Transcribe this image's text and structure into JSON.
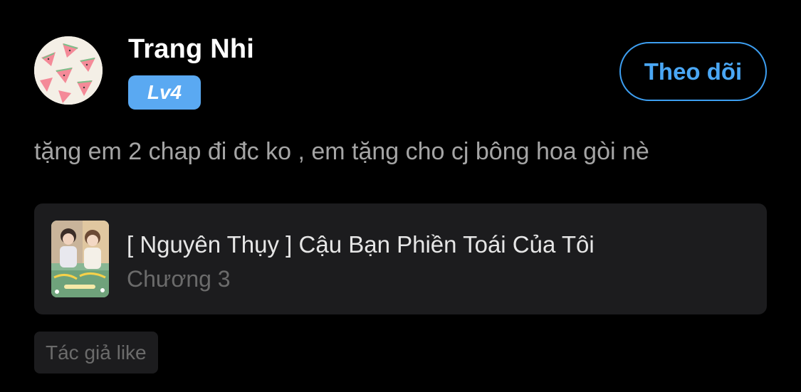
{
  "user": {
    "name": "Trang Nhi",
    "level": "Lv4",
    "avatar_icon": "watermelon-pattern-avatar"
  },
  "follow_button": {
    "label": "Theo dõi"
  },
  "comment": {
    "text": "tặng em 2 chap đi đc ko , em tặng cho cj  bông hoa gòi nè"
  },
  "story": {
    "title": "[ Nguyên Thụy ] Cậu Bạn Phiền Toái Của Tôi",
    "chapter": "Chương 3",
    "cover_icon": "story-cover-image"
  },
  "tag": {
    "label": "Tác giả like"
  },
  "colors": {
    "background": "#000000",
    "accent_blue": "#4aa7f5",
    "badge_blue": "#5aa9f2",
    "card_bg": "#1c1c1e",
    "muted_text": "#6b6b6b"
  }
}
